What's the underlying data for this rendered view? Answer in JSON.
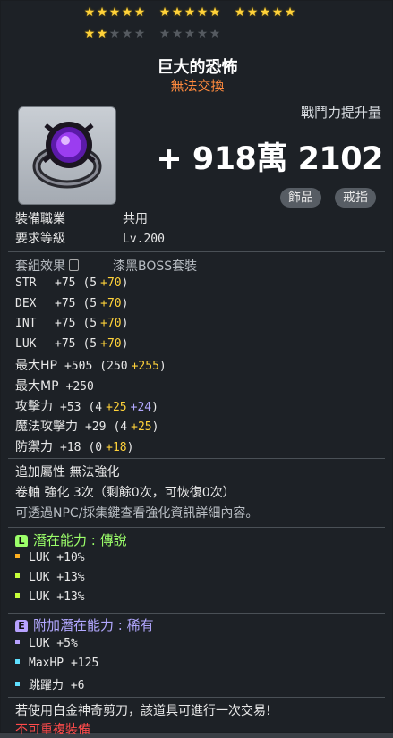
{
  "stars": {
    "total": 25,
    "filled": 17
  },
  "item": {
    "name": "巨大的恐怖",
    "trade_status": "無法交換",
    "cp_label": "戰鬥力提升量",
    "cp_value": "+ 918萬 2102",
    "tags": [
      "飾品",
      "戒指"
    ]
  },
  "req": {
    "job_label": "裝備職業",
    "job_value": "共用",
    "level_label": "要求等級",
    "level_value": "Lv.200"
  },
  "set": {
    "label": "套組效果",
    "value": "漆黑BOSS套裝"
  },
  "stats": [
    {
      "name": "STR",
      "total": "+75",
      "base": "(5",
      "bonus": "+70",
      "close": ")"
    },
    {
      "name": "DEX",
      "total": "+75",
      "base": "(5",
      "bonus": "+70",
      "close": ")"
    },
    {
      "name": "INT",
      "total": "+75",
      "base": "(5",
      "bonus": "+70",
      "close": ")"
    },
    {
      "name": "LUK",
      "total": "+75",
      "base": "(5",
      "bonus": "+70",
      "close": ")"
    },
    {
      "name": "最大HP",
      "total": "+505",
      "base": "(250",
      "bonus": "+255",
      "close": ")"
    },
    {
      "name": "最大MP",
      "total": "+250"
    },
    {
      "name": "攻擊力",
      "total": "+53",
      "base": "(4",
      "bonus": "+25",
      "extra": "+24",
      "close": ")"
    },
    {
      "name": "魔法攻擊力",
      "total": "+29",
      "base": "(4",
      "bonus": "+25",
      "close": ")"
    },
    {
      "name": "防禦力",
      "total": "+18",
      "base": "(0",
      "bonus": "+18",
      "close": ")"
    }
  ],
  "extra_attr": "追加屬性 無法強化",
  "scroll": "卷軸 強化 3次（剩餘0次，可恢復0次）",
  "npc_note": "可透過NPC/採集鍵查看強化資訊詳細內容。",
  "potential": {
    "badge": "L",
    "label": "潛在能力 :",
    "grade": "傳說",
    "lines": [
      "LUK +10%",
      "LUK +13%",
      "LUK +13%"
    ]
  },
  "bonus_potential": {
    "badge": "E",
    "label": "附加潛在能力 :",
    "grade": "稀有",
    "lines": [
      "LUK +5%",
      "MaxHP +125",
      "跳躍力 +6"
    ]
  },
  "scissors_note": "若使用白金神奇剪刀，該道具可進行一次交易!",
  "no_equip": "不可重複裝備",
  "colors": {
    "potential_badge": "#9cff6a",
    "bonus_badge": "#b7a2ff",
    "gold": "#ffd23a",
    "orange": "#ff8a3d"
  }
}
